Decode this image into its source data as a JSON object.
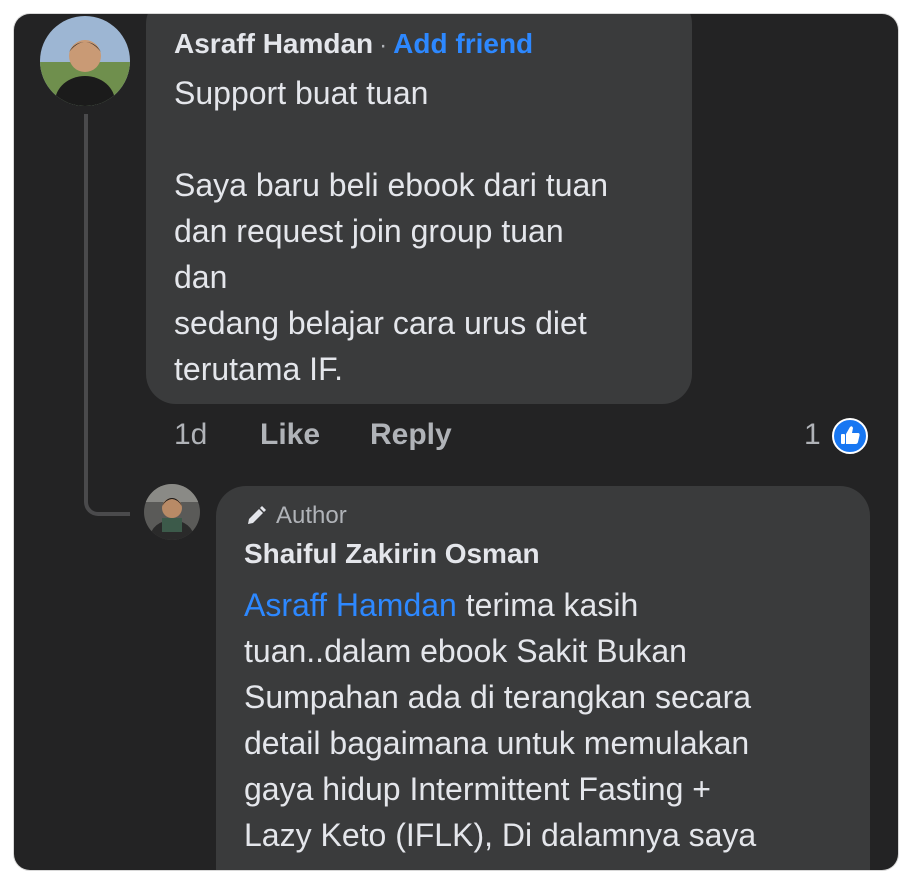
{
  "comment": {
    "author": "Asraff Hamdan",
    "separator": "·",
    "add_friend": "Add friend",
    "body": "Support buat tuan\n\nSaya baru beli ebook dari tuan\ndan request join group tuan\ndan\nsedang belajar cara urus diet\nterutama IF.",
    "time": "1d",
    "like_label": "Like",
    "reply_label": "Reply",
    "reaction_count": "1"
  },
  "reply": {
    "badge_icon": "pencil-icon",
    "badge": "Author",
    "author": "Shaiful Zakirin Osman",
    "mention": "Asraff Hamdan",
    "body": " terima kasih\ntuan..dalam ebook Sakit Bukan\nSumpahan ada di terangkan secara\ndetail bagaimana untuk memulakan\ngaya hidup Intermittent Fasting +\nLazy Keto (IFLK), Di dalamnya saya"
  },
  "colors": {
    "background": "#232324",
    "bubble": "#3a3b3c",
    "text": "#e4e6eb",
    "muted": "#b0b3b8",
    "link": "#2d88ff",
    "like": "#1877f2"
  }
}
